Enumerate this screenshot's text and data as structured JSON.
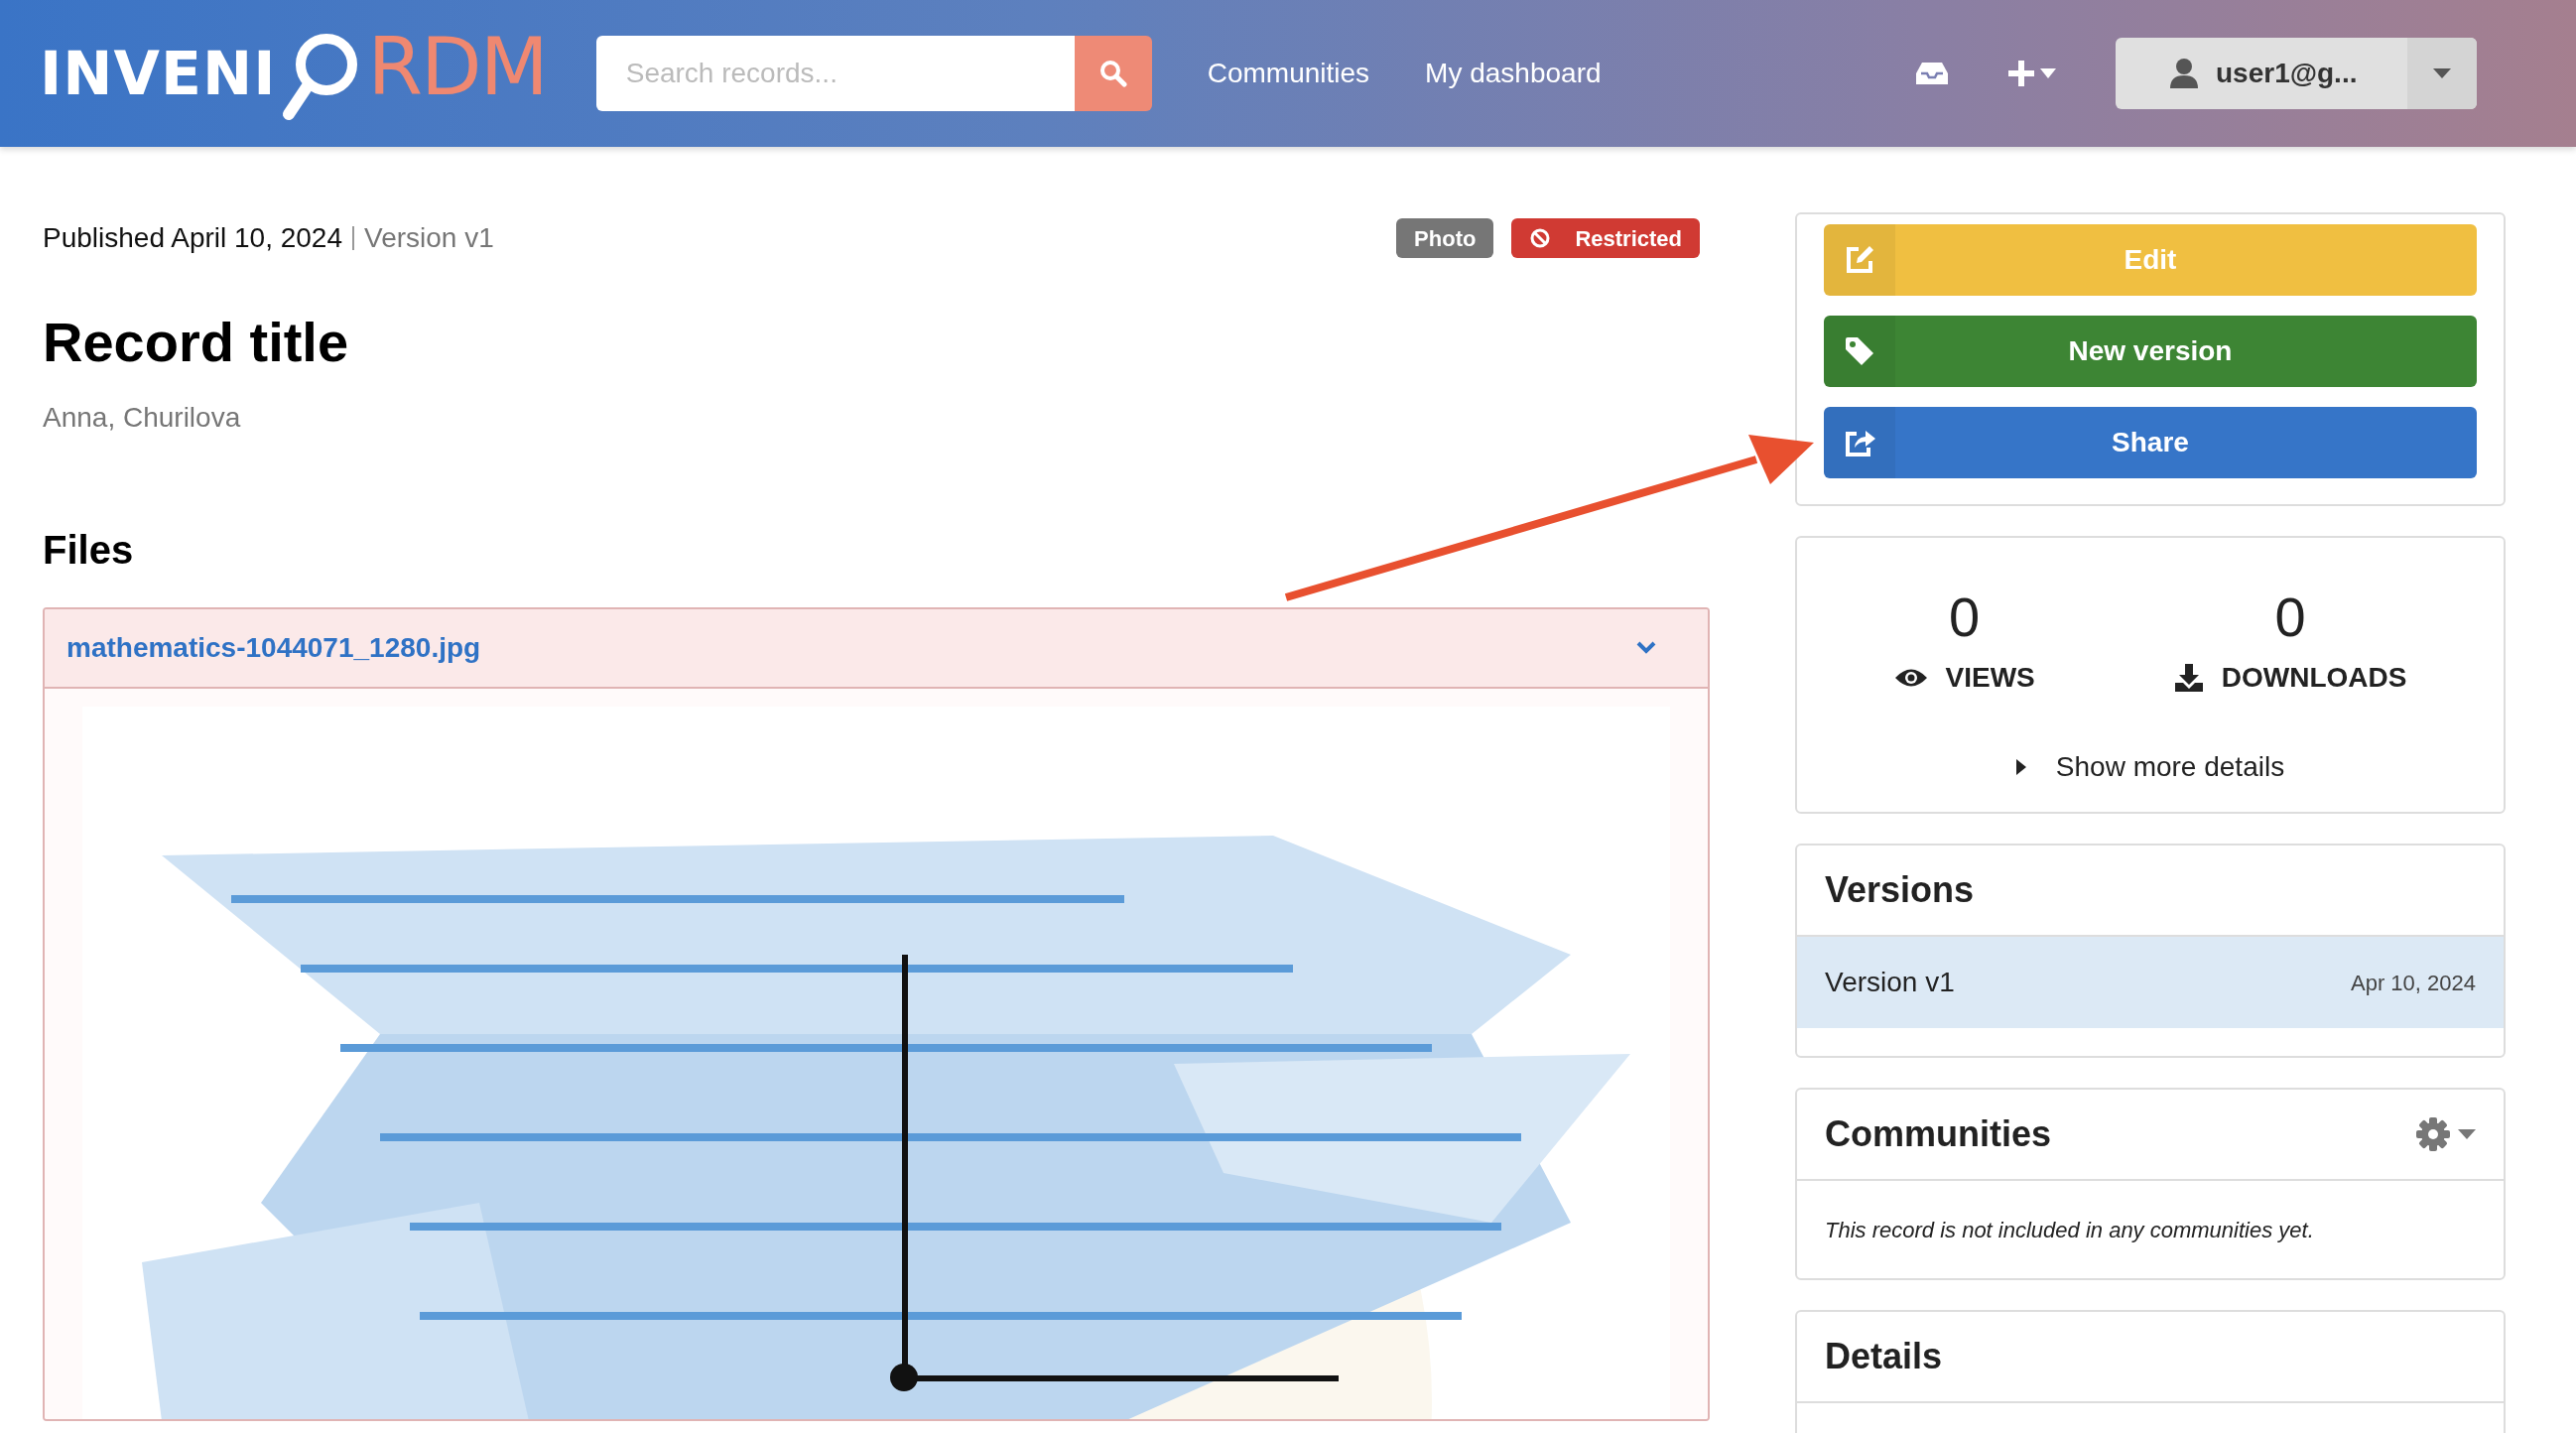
{
  "header": {
    "logo": {
      "part_1": "INVENI",
      "part_2": "RDM"
    },
    "search": {
      "placeholder": "Search records..."
    },
    "nav": [
      "Communities",
      "My dashboard"
    ],
    "user": "user1@g..."
  },
  "record": {
    "published": "Published April 10, 2024",
    "version": "Version v1",
    "badges": [
      {
        "label": "Photo",
        "kind": "resource_type"
      },
      {
        "label": "Restricted",
        "kind": "access"
      }
    ],
    "title": "Record title",
    "creators": "Anna, Churilova",
    "files": {
      "heading": "Files",
      "file_name": "mathematics-1044071_1280.jpg",
      "expanded": true
    }
  },
  "sidebar": {
    "actions": [
      {
        "label": "Edit",
        "kind": "edit"
      },
      {
        "label": "New version",
        "kind": "new_version"
      },
      {
        "label": "Share",
        "kind": "share"
      }
    ],
    "stats": [
      {
        "value": "0",
        "label": "VIEWS",
        "kind": "views"
      },
      {
        "value": "0",
        "label": "DOWNLOADS",
        "kind": "downloads"
      }
    ],
    "show_more": "Show more details",
    "versions": {
      "title": "Versions",
      "items": [
        {
          "label": "Version v1",
          "date": "Apr 10, 2024",
          "selected": true
        }
      ]
    },
    "communities": {
      "title": "Communities",
      "message": "This record is not included in any communities yet."
    },
    "details": {
      "title": "Details"
    }
  },
  "annotation": {
    "kind": "arrow"
  }
}
